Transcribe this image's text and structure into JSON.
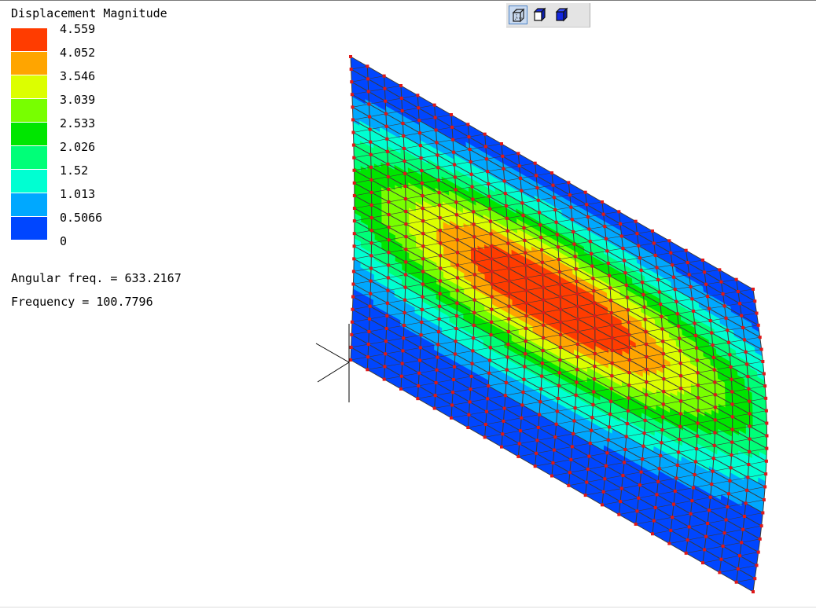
{
  "legend": {
    "title": "Displacement Magnitude",
    "levels": [
      "4.559",
      "4.052",
      "3.546",
      "3.039",
      "2.533",
      "2.026",
      "1.52",
      "1.013",
      "0.5066",
      "0"
    ],
    "colors": [
      "#ff3c00",
      "#ffa500",
      "#dcff00",
      "#78ff00",
      "#00e600",
      "#00ff78",
      "#00ffd2",
      "#00a8ff",
      "#0046ff"
    ]
  },
  "info": {
    "angular_freq": "Angular freq. = 633.2167",
    "frequency": "Frequency = 100.7796"
  },
  "toolbar": {
    "buttons": [
      {
        "icon": "wireframe-cube-icon",
        "active": true
      },
      {
        "icon": "shaded-cube-icon",
        "active": false
      },
      {
        "icon": "solid-cube-icon",
        "active": false
      }
    ]
  },
  "mesh": {
    "node_color": "#e01818",
    "edge_color": "#3a3a3a",
    "grid_divisions": 24
  }
}
